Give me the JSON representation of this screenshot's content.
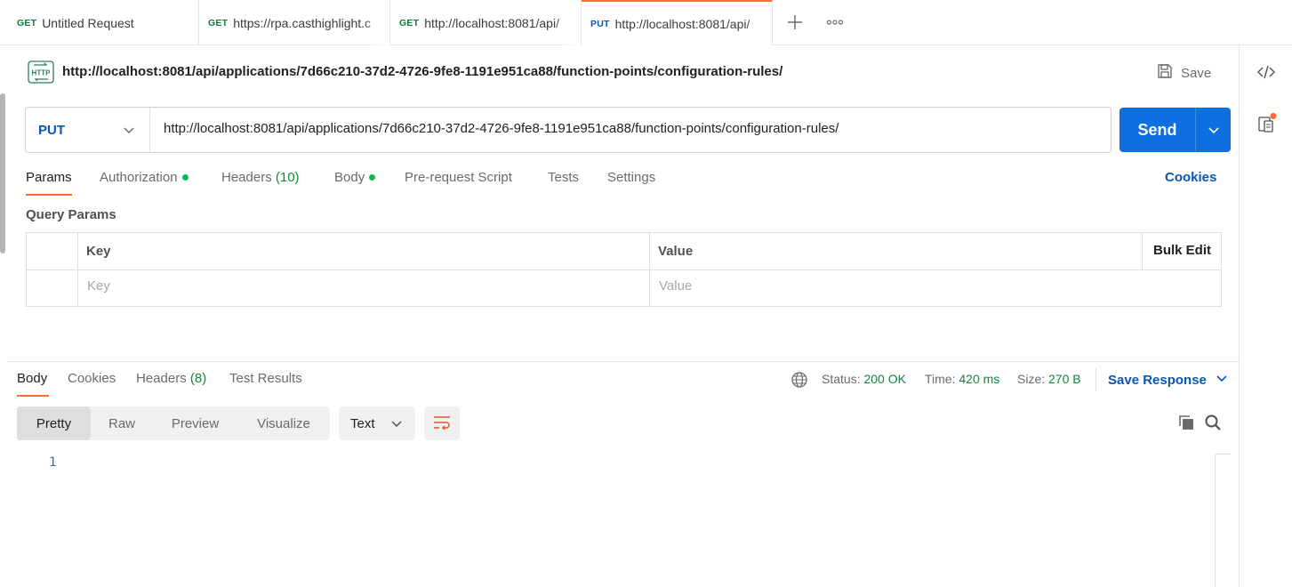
{
  "tabs": [
    {
      "method": "GET",
      "title": "Untitled Request",
      "method_color": "#0a7d3a"
    },
    {
      "method": "GET",
      "title": "https://rpa.casthighlight.c",
      "method_color": "#0a7d3a"
    },
    {
      "method": "GET",
      "title": "http://localhost:8081/api/",
      "method_color": "#0a7d3a"
    },
    {
      "method": "PUT",
      "title": "http://localhost:8081/api/",
      "method_color": "#0b56b3"
    }
  ],
  "request": {
    "title_url": "http://localhost:8081/api/applications/7d66c210-37d2-4726-9fe8-1191e951ca88/function-points/configuration-rules/",
    "save_label": "Save",
    "method": "PUT",
    "url": "http://localhost:8081/api/applications/7d66c210-37d2-4726-9fe8-1191e951ca88/function-points/configuration-rules/",
    "send_label": "Send",
    "tabs": {
      "params": "Params",
      "authorization": "Authorization",
      "headers": "Headers",
      "headers_count": "(10)",
      "body": "Body",
      "prerequest": "Pre-request Script",
      "tests": "Tests",
      "settings": "Settings"
    },
    "cookies_label": "Cookies",
    "query_params_label": "Query Params",
    "table": {
      "key_header": "Key",
      "value_header": "Value",
      "bulk_edit": "Bulk Edit",
      "key_placeholder": "Key",
      "value_placeholder": "Value"
    }
  },
  "response": {
    "tabs": {
      "body": "Body",
      "cookies": "Cookies",
      "headers": "Headers",
      "headers_count": "(8)",
      "test_results": "Test Results"
    },
    "status_label": "Status:",
    "status_value": "200 OK",
    "time_label": "Time:",
    "time_value": "420 ms",
    "size_label": "Size:",
    "size_value": "270 B",
    "save_response": "Save Response",
    "formats": [
      "Pretty",
      "Raw",
      "Preview",
      "Visualize"
    ],
    "text_type": "Text",
    "line_number": "1"
  },
  "colors": {
    "accent": "#ff6c37",
    "send": "#0f6fe0",
    "link": "#0b56b3",
    "success": "#0a8a3a"
  }
}
